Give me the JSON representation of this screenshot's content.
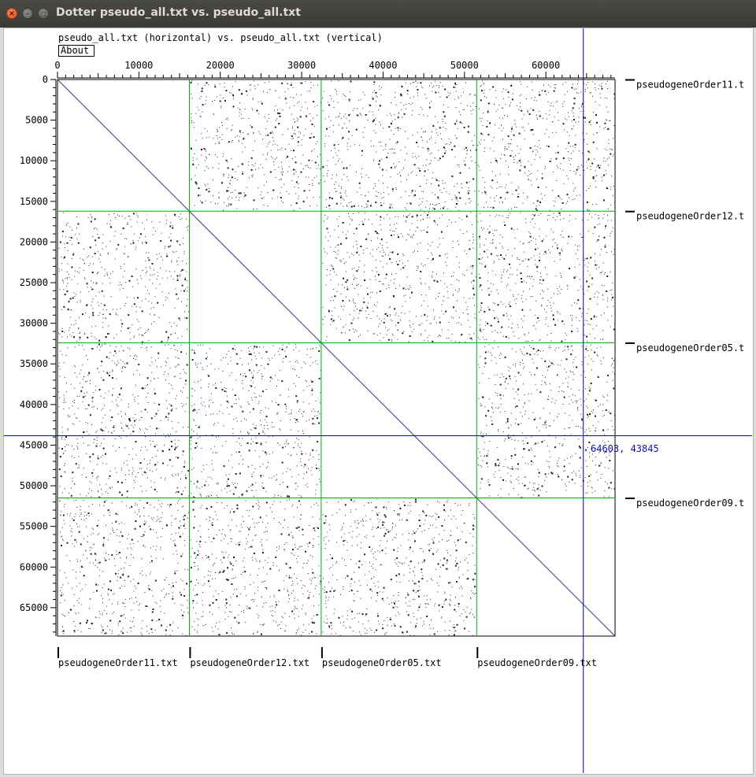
{
  "window": {
    "title": "Dotter pseudo_all.txt vs. pseudo_all.txt",
    "controls": [
      "close-icon",
      "minimize-icon",
      "maximize-icon"
    ]
  },
  "header": {
    "description": "pseudo_all.txt (horizontal) vs. pseudo_all.txt (vertical)",
    "about_label": "About"
  },
  "crosshair": {
    "x": 64603,
    "y": 43845,
    "label": "64603, 43845",
    "color": "#0000cc"
  },
  "chart_data": {
    "type": "scatter",
    "xlim": [
      0,
      68500
    ],
    "ylim": [
      0,
      68500
    ],
    "y_inverted": true,
    "x_ticks": [
      0,
      10000,
      20000,
      30000,
      40000,
      50000,
      60000
    ],
    "y_ticks": [
      0,
      5000,
      10000,
      15000,
      20000,
      25000,
      30000,
      35000,
      40000,
      45000,
      50000,
      55000,
      60000,
      65000
    ],
    "sequence_boundaries": [
      0,
      16200,
      32400,
      51500,
      68500
    ],
    "boundary_color": "#00aa00",
    "horizontal_sequences": [
      "pseudogeneOrder11.txt",
      "pseudogeneOrder12.txt",
      "pseudogeneOrder05.txt",
      "pseudogeneOrder09.txt"
    ],
    "vertical_sequences": [
      "pseudogeneOrder11.t",
      "pseudogeneOrder12.t",
      "pseudogeneOrder05.t",
      "pseudogeneOrder09.t"
    ],
    "diagonal": {
      "from": [
        0,
        0
      ],
      "to": [
        68500,
        68500
      ]
    }
  }
}
